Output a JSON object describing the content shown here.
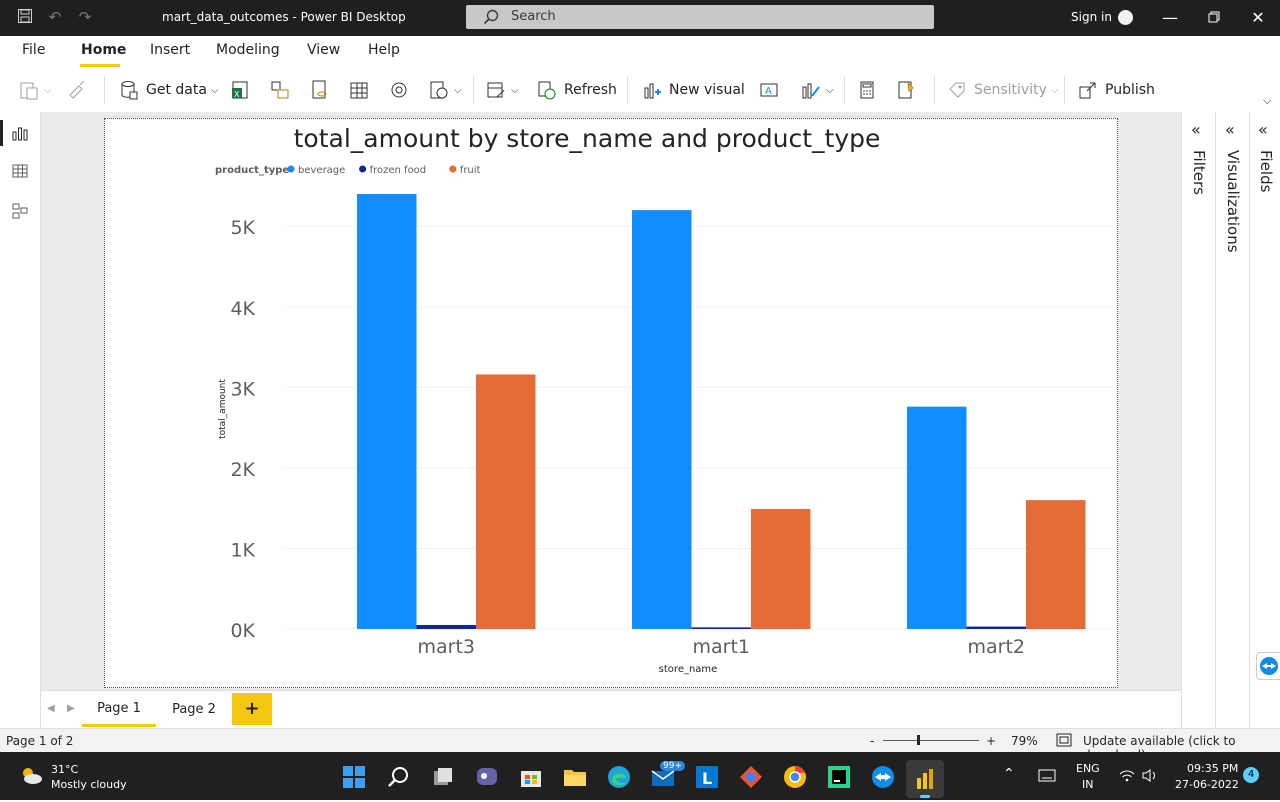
{
  "window": {
    "title": "mart_data_outcomes - Power BI Desktop",
    "search_placeholder": "Search",
    "sign_in": "Sign in"
  },
  "menu": {
    "items": [
      "File",
      "Home",
      "Insert",
      "Modeling",
      "View",
      "Help"
    ],
    "active": "Home"
  },
  "ribbon": {
    "get_data": "Get data",
    "refresh": "Refresh",
    "new_visual": "New visual",
    "sensitivity": "Sensitivity",
    "publish": "Publish"
  },
  "right_panes": {
    "filters": "Filters",
    "visualizations": "Visualizations",
    "fields": "Fields"
  },
  "chart_data": {
    "type": "bar",
    "title": "total_amount by store_name and product_type",
    "legend_title": "product_type",
    "legend_position": "top-left",
    "xlabel": "store_name",
    "ylabel": "total_amount",
    "categories": [
      "mart3",
      "mart1",
      "mart2"
    ],
    "series": [
      {
        "name": "beverage",
        "color": "#118dff",
        "values": [
          5400,
          5200,
          2760
        ]
      },
      {
        "name": "frozen food",
        "color": "#12239e",
        "values": [
          50,
          20,
          30
        ]
      },
      {
        "name": "fruit",
        "color": "#e66c37",
        "values": [
          3160,
          1490,
          1600
        ]
      }
    ],
    "yticks": [
      0,
      1000,
      2000,
      3000,
      4000,
      5000
    ],
    "ytick_labels": [
      "0K",
      "1K",
      "2K",
      "3K",
      "4K",
      "5K"
    ],
    "ylim": [
      0,
      5400
    ],
    "grid": true
  },
  "pages": {
    "tabs": [
      "Page 1",
      "Page 2"
    ],
    "active": "Page 1",
    "add": "+"
  },
  "status": {
    "page_info": "Page 1 of 2",
    "zoom_minus": "-",
    "zoom_plus": "+",
    "zoom": "79%",
    "update": "Update available (click to download)"
  },
  "taskbar": {
    "temperature": "31°C",
    "weather": "Mostly cloudy",
    "badge": "99+",
    "lang_top": "ENG",
    "lang_bottom": "IN",
    "time": "09:35 PM",
    "date": "27-06-2022",
    "notifications": "4"
  }
}
